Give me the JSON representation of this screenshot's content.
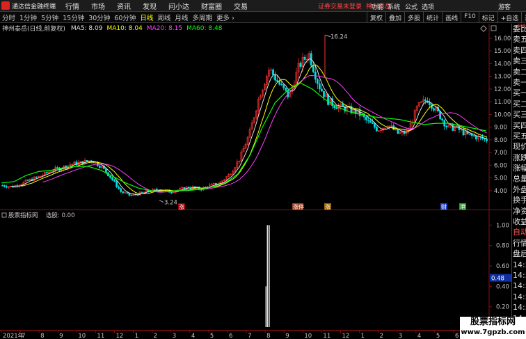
{
  "app": {
    "title": "通达信金融终端"
  },
  "menu": [
    "行情",
    "市场",
    "资讯",
    "发现",
    "问小达",
    "财富圈",
    "交易"
  ],
  "login": {
    "warning": "证券交易未登录",
    "stock": "神州泰岳"
  },
  "right_menu": [
    "功能",
    "系统",
    "公式",
    "选项"
  ],
  "guest": "游客",
  "periods": [
    {
      "label": "分时",
      "active": false
    },
    {
      "label": "1分钟",
      "active": false
    },
    {
      "label": "5分钟",
      "active": false
    },
    {
      "label": "15分钟",
      "active": false
    },
    {
      "label": "30分钟",
      "active": false
    },
    {
      "label": "60分钟",
      "active": false
    },
    {
      "label": "日线",
      "active": true
    },
    {
      "label": "周线",
      "active": false
    },
    {
      "label": "月线",
      "active": false
    },
    {
      "label": "多周期",
      "active": false
    },
    {
      "label": "更多",
      "active": false
    }
  ],
  "tools": [
    "复权",
    "叠加",
    "多股",
    "统计",
    "画线",
    "F10",
    "标记",
    "+自选",
    "返回"
  ],
  "info": {
    "stock_name": "神州泰岳(日线,前复权)",
    "ma": [
      {
        "label": "MA5: 8.09",
        "color": "#e0e0e0"
      },
      {
        "label": "MA10: 8.04",
        "color": "#ffff00"
      },
      {
        "label": "MA20: 8.15",
        "color": "#ff40ff"
      },
      {
        "label": "MA60: 8.48",
        "color": "#00ff00"
      }
    ]
  },
  "indicator": {
    "title": "股票指标网",
    "label": "选股: 0.00",
    "value_marker": "0.48"
  },
  "side_panel": {
    "items": [
      {
        "label": "委比",
        "red": false
      },
      {
        "label": "卖五",
        "red": false
      },
      {
        "label": "卖四",
        "red": false
      },
      {
        "label": "卖三",
        "red": false
      },
      {
        "label": "卖二",
        "red": false
      },
      {
        "label": "卖一",
        "red": false
      },
      {
        "label": "买一",
        "red": false
      },
      {
        "label": "买二",
        "red": false
      },
      {
        "label": "买三",
        "red": false
      },
      {
        "label": "买四",
        "red": false
      },
      {
        "label": "买五",
        "red": false
      },
      {
        "label": "现价",
        "red": false
      },
      {
        "label": "涨跌",
        "red": false
      },
      {
        "label": "涨幅",
        "red": false
      },
      {
        "label": "总量",
        "red": false
      },
      {
        "label": "外盘",
        "red": false
      },
      {
        "label": "换手",
        "red": false
      },
      {
        "label": "净资",
        "red": false
      },
      {
        "label": "收益",
        "red": false
      },
      {
        "label": "自动",
        "red": true
      },
      {
        "label": "行情",
        "red": false
      },
      {
        "label": "盘后",
        "red": false
      },
      {
        "label": "14:50",
        "red": false
      },
      {
        "label": "14:50",
        "red": false
      },
      {
        "label": "14:50",
        "red": false
      },
      {
        "label": "14:50",
        "red": false
      },
      {
        "label": "14:50",
        "red": false
      },
      {
        "label": "14:50",
        "red": false
      },
      {
        "label": "14:50",
        "red": false
      }
    ],
    "top_marker": "500"
  },
  "watermark": {
    "title": "股票指标网",
    "url": "www.7gpzb.com"
  },
  "annotations": {
    "high": "16.24",
    "low": "3.24",
    "tags": [
      "涨",
      "涨停",
      "涨",
      "财",
      "港"
    ]
  },
  "axis": {
    "year_label": "2021年"
  },
  "chart_data": [
    {
      "type": "candlestick",
      "title": "神州泰岳(日线,前复权)",
      "y_ticks": [
        4.0,
        5.0,
        6.0,
        7.0,
        8.0,
        9.0,
        10.0,
        11.0,
        12.0,
        13.0,
        14.0,
        15.0,
        16.0
      ],
      "ylim": [
        3.0,
        16.6
      ],
      "high_label": 16.24,
      "low_label": 3.24,
      "close_path": [
        4.4,
        4.3,
        4.6,
        4.9,
        5.2,
        5.6,
        5.8,
        6.1,
        6.2,
        6.4,
        5.9,
        5.0,
        3.9,
        3.6,
        3.8,
        4.0,
        4.1,
        3.9,
        4.1,
        4.3,
        4.1,
        4.4,
        4.6,
        5.3,
        6.5,
        8.5,
        11.5,
        13.6,
        12.4,
        11.4,
        13.8,
        14.8,
        12.3,
        11.0,
        10.6,
        10.4,
        10.1,
        9.4,
        8.8,
        9.2,
        8.5,
        8.6,
        10.6,
        11.2,
        10.2,
        9.0,
        8.9,
        8.4,
        8.2,
        8.0
      ],
      "ma60_path": [
        4.6,
        4.7,
        5.2,
        5.5,
        5.6,
        5.8,
        5.9,
        5.9,
        5.6,
        5.1,
        4.6,
        4.2,
        4.0,
        3.9,
        4.0,
        4.0,
        4.1,
        4.3,
        4.6,
        5.3,
        6.8,
        9.0,
        10.9,
        11.9,
        12.5,
        12.0,
        11.2,
        10.6,
        10.2,
        10.0,
        9.8,
        9.7,
        9.6,
        9.4,
        9.2,
        9.3,
        9.3,
        9.1,
        8.9,
        8.7
      ]
    },
    {
      "type": "bar",
      "title": "股票指标网",
      "y_ticks": [
        0.0,
        0.2,
        0.4,
        0.6,
        0.8,
        1.0
      ],
      "ylim": [
        0.0,
        1.05
      ],
      "signal_at_fraction": 0.548,
      "signal_value": 1.0,
      "current_value": 0.0
    }
  ],
  "x_axis_months": [
    "2021年",
    "7",
    "8",
    "9",
    "10",
    "11",
    "12",
    "1",
    "2",
    "3",
    "4",
    "5",
    "6",
    "7",
    "8",
    "9",
    "10",
    "11",
    "12",
    "1",
    "2",
    "3",
    "4",
    "5",
    "6"
  ]
}
